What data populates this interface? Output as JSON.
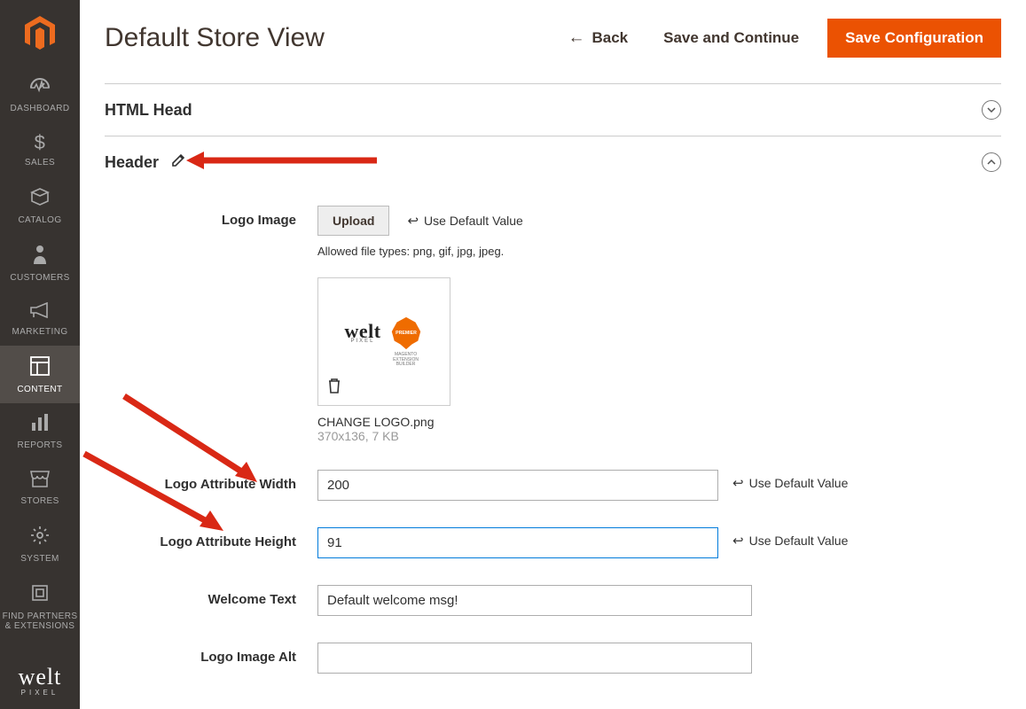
{
  "page": {
    "title": "Default Store View",
    "back": "Back",
    "save_continue": "Save and Continue",
    "save_config": "Save Configuration"
  },
  "sidebar": {
    "items": [
      {
        "label": "DASHBOARD",
        "icon": "dashboard"
      },
      {
        "label": "SALES",
        "icon": "dollar"
      },
      {
        "label": "CATALOG",
        "icon": "catalog"
      },
      {
        "label": "CUSTOMERS",
        "icon": "person"
      },
      {
        "label": "MARKETING",
        "icon": "megaphone"
      },
      {
        "label": "CONTENT",
        "icon": "content"
      },
      {
        "label": "REPORTS",
        "icon": "reports"
      },
      {
        "label": "STORES",
        "icon": "stores"
      },
      {
        "label": "SYSTEM",
        "icon": "system"
      },
      {
        "label": "FIND PARTNERS & EXTENSIONS",
        "icon": "partners"
      }
    ],
    "brand": "welt",
    "brand_sub": "PIXEL"
  },
  "sections": {
    "html_head": "HTML Head",
    "header": "Header"
  },
  "form": {
    "labels": {
      "logo_image": "Logo Image",
      "attr_width": "Logo Attribute Width",
      "attr_height": "Logo Attribute Height",
      "welcome_text": "Welcome Text",
      "logo_alt": "Logo Image Alt"
    },
    "upload": "Upload",
    "use_default": "Use Default Value",
    "file_hint": "Allowed file types: png, gif, jpg, jpeg.",
    "image_name": "CHANGE LOGO.png",
    "image_meta": "370x136, 7 KB",
    "values": {
      "width": "200",
      "height": "91",
      "welcome": "Default welcome msg!",
      "alt": ""
    },
    "preview_badge": "MAGENTO EXTENSION BUILDER",
    "preview_ribbon": "PREMIER"
  }
}
